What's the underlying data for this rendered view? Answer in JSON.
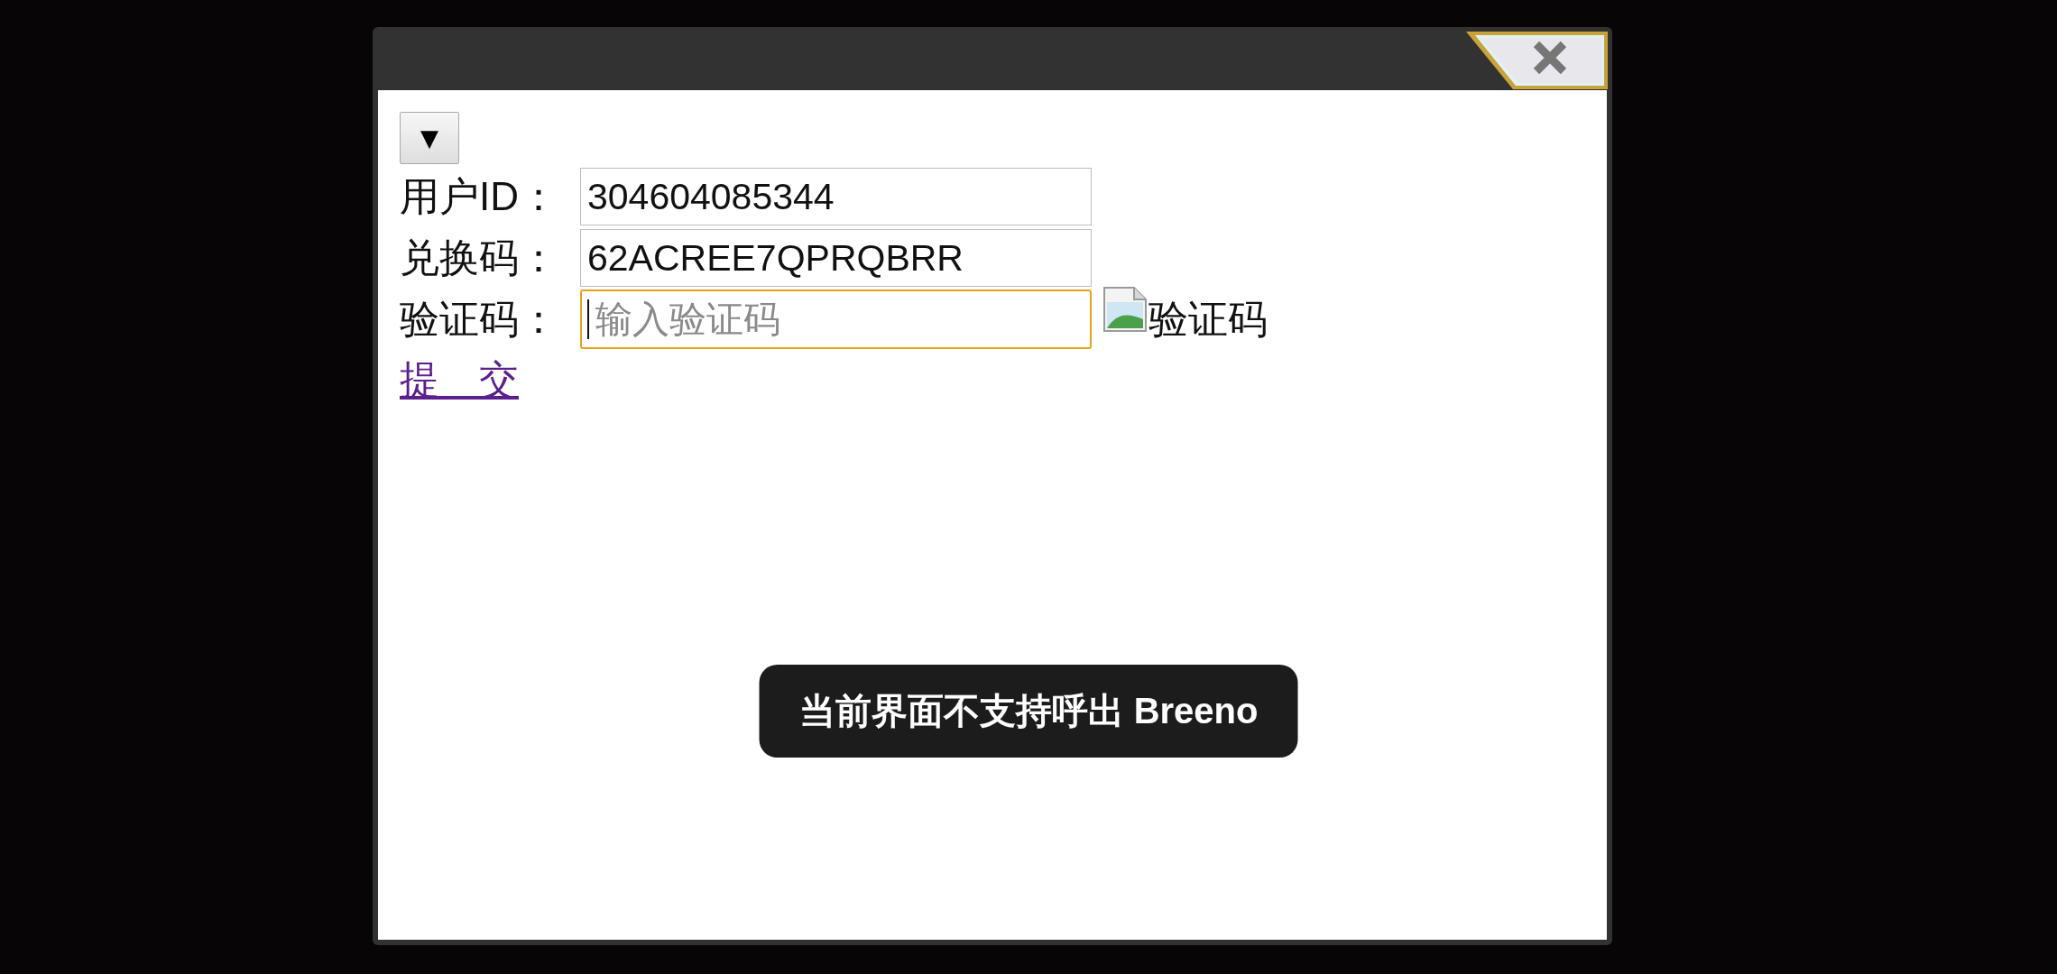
{
  "dialog": {
    "dropdown_button": {
      "label": "▼"
    },
    "fields": [
      {
        "label": "用户ID：",
        "value": "304604085344",
        "focused": false
      },
      {
        "label": "兑换码：",
        "value": "62ACREE7QPRQBRR",
        "focused": false
      },
      {
        "label": "验证码：",
        "placeholder": "输入验证码",
        "focused": true,
        "captcha_image": {
          "alt": "验证码"
        }
      }
    ],
    "submit_link": {
      "label": "提　交"
    }
  },
  "toast": {
    "text": "当前界面不支持呼出 Breeno"
  }
}
